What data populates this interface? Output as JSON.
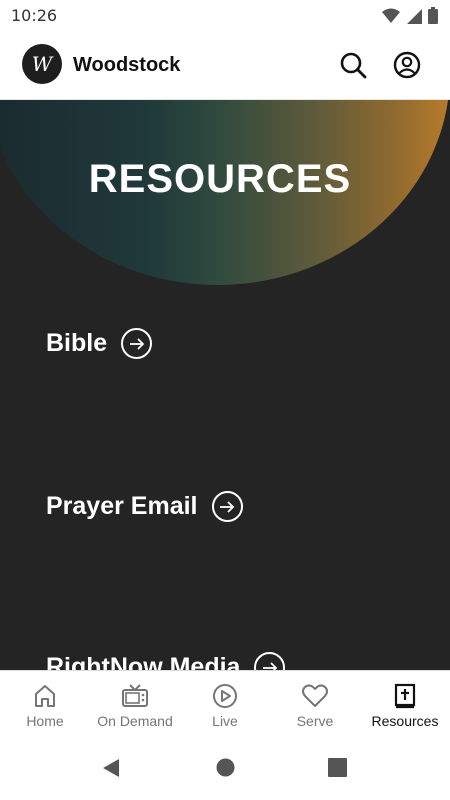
{
  "status_bar": {
    "time": "10:26"
  },
  "header": {
    "logo_letter": "W",
    "title": "Woodstock"
  },
  "hero": {
    "title": "RESOURCES"
  },
  "resources": [
    {
      "label": "Bible"
    },
    {
      "label": "Prayer Email"
    },
    {
      "label": "RightNow Media"
    }
  ],
  "bottom_nav": {
    "items": [
      {
        "label": "Home",
        "icon": "home-icon",
        "active": false
      },
      {
        "label": "On Demand",
        "icon": "tv-icon",
        "active": false
      },
      {
        "label": "Live",
        "icon": "play-circle-icon",
        "active": false
      },
      {
        "label": "Serve",
        "icon": "heart-icon",
        "active": false
      },
      {
        "label": "Resources",
        "icon": "bible-icon",
        "active": true
      }
    ]
  },
  "colors": {
    "hero_gradient_start": "#1a2a2e",
    "hero_gradient_end": "#b87a2c",
    "content_background": "#242424"
  }
}
